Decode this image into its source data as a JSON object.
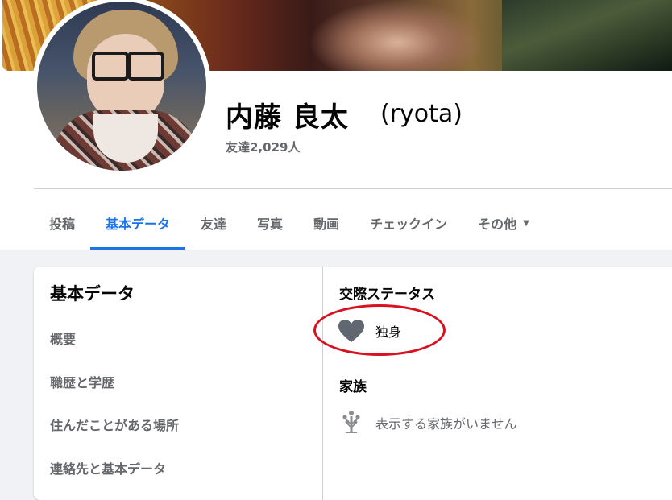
{
  "profile": {
    "name": "内藤 良太",
    "alternate_name": "(ryota)",
    "friends_count": "友達2,029人"
  },
  "tabs": [
    {
      "label": "投稿",
      "active": false
    },
    {
      "label": "基本データ",
      "active": true
    },
    {
      "label": "友達",
      "active": false
    },
    {
      "label": "写真",
      "active": false
    },
    {
      "label": "動画",
      "active": false
    },
    {
      "label": "チェックイン",
      "active": false
    },
    {
      "label": "その他",
      "active": false,
      "has_dropdown": true
    }
  ],
  "about": {
    "title": "基本データ",
    "nav": [
      "概要",
      "職歴と学歴",
      "住んだことがある場所",
      "連絡先と基本データ"
    ]
  },
  "relationship": {
    "title": "交際ステータス",
    "value": "独身",
    "icon": "heart-icon"
  },
  "family": {
    "title": "家族",
    "empty_text": "表示する家族がいません",
    "icon": "family-tree-icon"
  },
  "colors": {
    "accent": "#1b74e4",
    "annotation": "#d8101f",
    "muted_text": "#65676b"
  }
}
